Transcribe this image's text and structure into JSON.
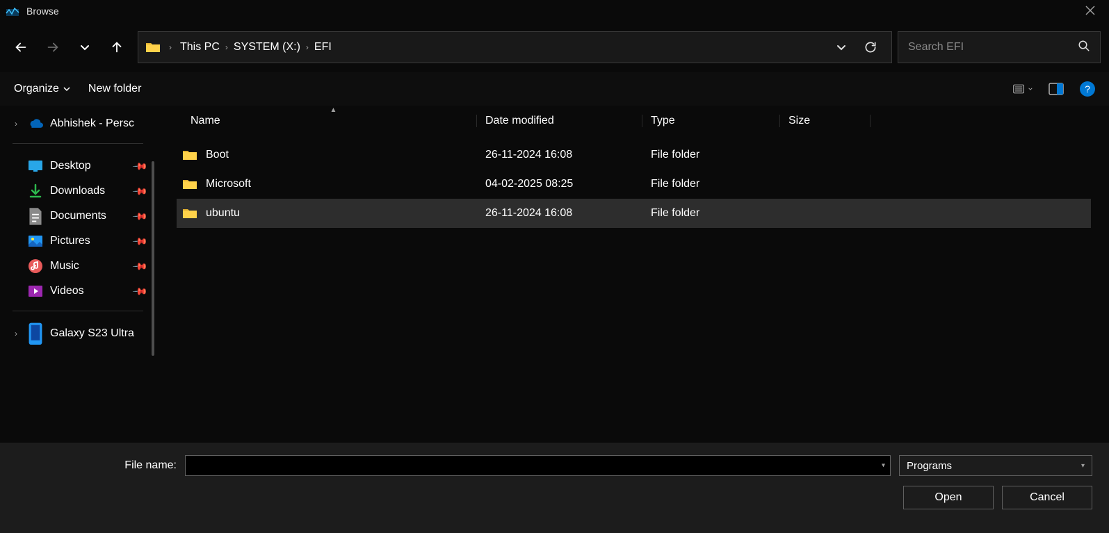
{
  "title": "Browse",
  "breadcrumb": [
    "This PC",
    "SYSTEM (X:)",
    "EFI"
  ],
  "search": {
    "placeholder": "Search EFI"
  },
  "toolbar": {
    "organize": "Organize",
    "new_folder": "New folder"
  },
  "sidebar": {
    "onedrive": "Abhishek - Persc",
    "items": [
      {
        "label": "Desktop",
        "icon": "desktop"
      },
      {
        "label": "Downloads",
        "icon": "download"
      },
      {
        "label": "Documents",
        "icon": "document"
      },
      {
        "label": "Pictures",
        "icon": "picture"
      },
      {
        "label": "Music",
        "icon": "music"
      },
      {
        "label": "Videos",
        "icon": "video"
      }
    ],
    "device": "Galaxy S23 Ultra"
  },
  "columns": {
    "name": "Name",
    "date": "Date modified",
    "type": "Type",
    "size": "Size"
  },
  "rows": [
    {
      "name": "Boot",
      "date": "26-11-2024 16:08",
      "type": "File folder",
      "size": "",
      "selected": false
    },
    {
      "name": "Microsoft",
      "date": "04-02-2025 08:25",
      "type": "File folder",
      "size": "",
      "selected": false
    },
    {
      "name": "ubuntu",
      "date": "26-11-2024 16:08",
      "type": "File folder",
      "size": "",
      "selected": true
    }
  ],
  "footer": {
    "filename_label": "File name:",
    "filename_value": "",
    "filter": "Programs",
    "open": "Open",
    "cancel": "Cancel"
  }
}
